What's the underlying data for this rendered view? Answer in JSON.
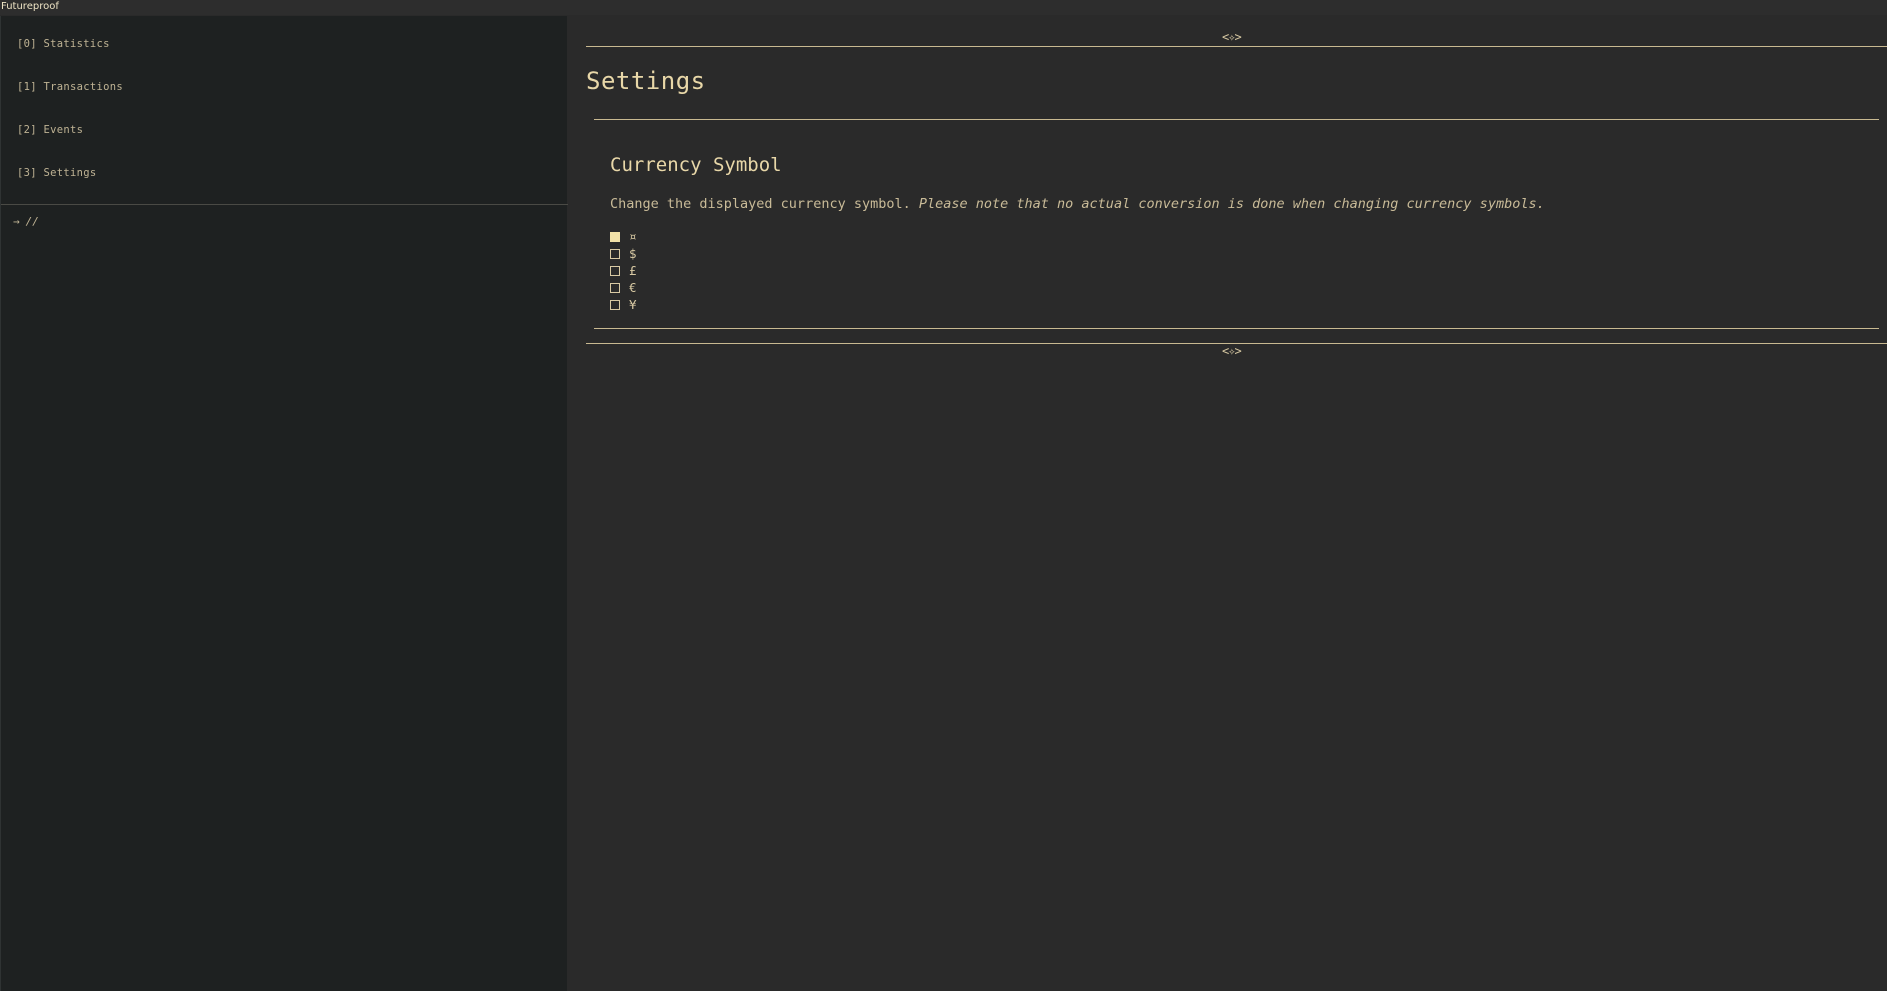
{
  "window": {
    "title": "Futureproof"
  },
  "sidebar": {
    "items": [
      {
        "key": "[0]",
        "label": "Statistics"
      },
      {
        "key": "[1]",
        "label": "Transactions"
      },
      {
        "key": "[2]",
        "label": "Events"
      },
      {
        "key": "[3]",
        "label": "Settings"
      }
    ],
    "path": {
      "arrow": "→",
      "text": "//"
    }
  },
  "main": {
    "ornament": "<✧>",
    "title": "Settings",
    "currency": {
      "title": "Currency Symbol",
      "description": "Change the displayed currency symbol.",
      "note": "Please note that no actual conversion is done when changing currency symbols.",
      "selected_index": 0,
      "options": [
        "¤",
        "$",
        "£",
        "€",
        "¥"
      ]
    }
  },
  "colors": {
    "background": "#2a2a2a",
    "sidebar": "#1e2121",
    "accent": "#e8d7a8",
    "text": "#d8c9a3"
  }
}
